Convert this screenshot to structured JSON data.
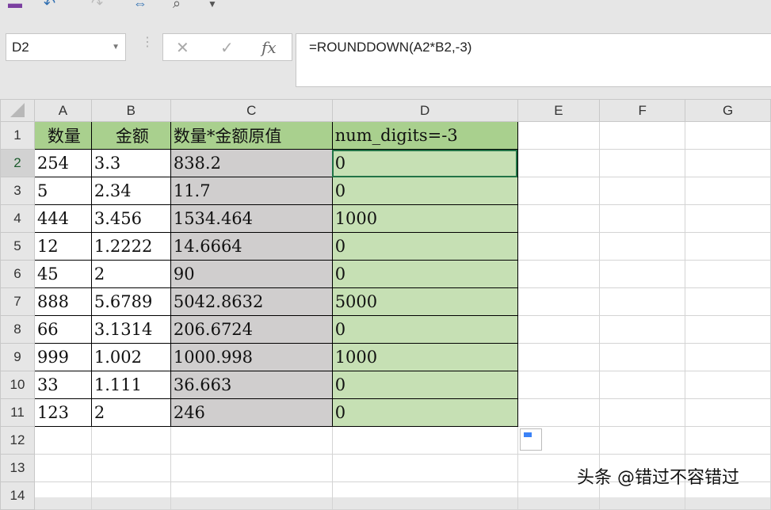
{
  "quick_access": {
    "save_icon": "save-icon",
    "undo_icon": "undo-icon",
    "redo_icon": "redo-icon"
  },
  "name_box": "D2",
  "formula_bar": {
    "cancel": "✕",
    "enter": "✓",
    "fx": "fx",
    "formula": "=ROUNDDOWN(A2*B2,-3)"
  },
  "columns": [
    "A",
    "B",
    "C",
    "D",
    "E",
    "F",
    "G"
  ],
  "rows": [
    "1",
    "2",
    "3",
    "4",
    "5",
    "6",
    "7",
    "8",
    "9",
    "10",
    "11",
    "12",
    "13",
    "14"
  ],
  "headers": [
    "数量",
    "金额",
    "数量*金额原值",
    "num_digits=-3"
  ],
  "data": [
    [
      "254",
      "3.3",
      "838.2",
      "0"
    ],
    [
      "5",
      "2.34",
      "11.7",
      "0"
    ],
    [
      "444",
      "3.456",
      "1534.464",
      "1000"
    ],
    [
      "12",
      "1.2222",
      "14.6664",
      "0"
    ],
    [
      "45",
      "2",
      "90",
      "0"
    ],
    [
      "888",
      "5.6789",
      "5042.8632",
      "5000"
    ],
    [
      "66",
      "3.1314",
      "206.6724",
      "0"
    ],
    [
      "999",
      "1.002",
      "1000.998",
      "1000"
    ],
    [
      "33",
      "1.111",
      "36.663",
      "0"
    ],
    [
      "123",
      "2",
      "246",
      "0"
    ]
  ],
  "watermark": "头条 @错过不容错过",
  "colors": {
    "header": "#a9d08e",
    "col_c": "#d0cece",
    "col_d": "#c6e0b4"
  }
}
